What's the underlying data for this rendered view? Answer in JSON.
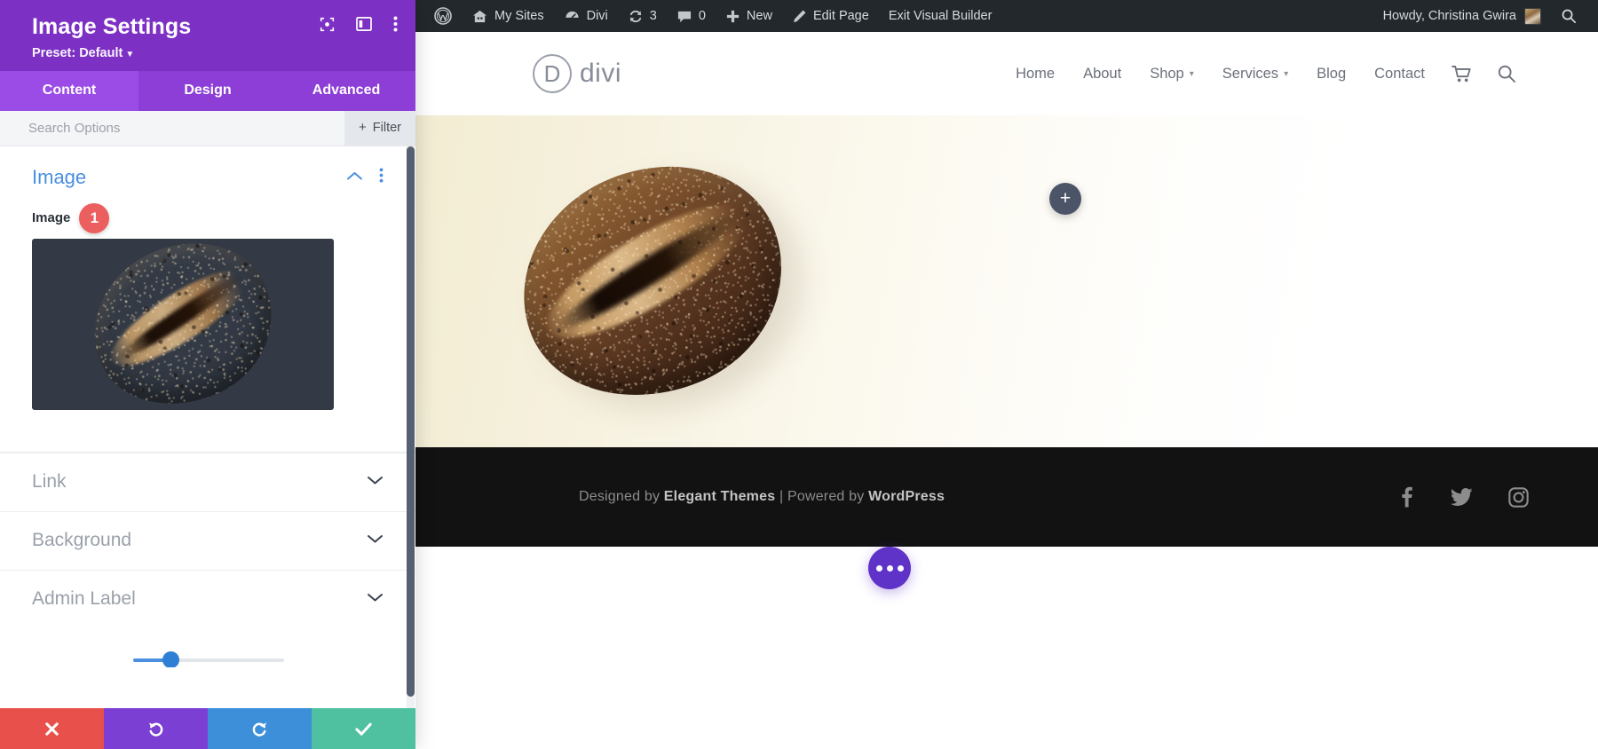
{
  "settings_panel": {
    "title": "Image Settings",
    "preset_label": "Preset: Default",
    "header_icons": [
      {
        "name": "focus-target-icon",
        "label": "Focus"
      },
      {
        "name": "panel-layout-icon",
        "label": "Layout"
      },
      {
        "name": "more-options-icon",
        "label": "More"
      }
    ],
    "tabs": [
      {
        "label": "Content",
        "active": true
      },
      {
        "label": "Design",
        "active": false
      },
      {
        "label": "Advanced",
        "active": false
      }
    ],
    "search": {
      "placeholder": "Search Options",
      "value": ""
    },
    "filter_button": {
      "label": "Filter",
      "plus": "+"
    },
    "sections": [
      {
        "title": "Image",
        "state": "expanded",
        "field_label": "Image",
        "badge": "1"
      },
      {
        "title": "Link",
        "state": "collapsed"
      },
      {
        "title": "Background",
        "state": "collapsed"
      },
      {
        "title": "Admin Label",
        "state": "collapsed"
      }
    ],
    "action_bar": [
      {
        "name": "cancel-button",
        "icon": "close-icon",
        "glyph": "✖",
        "color": "#e8514b"
      },
      {
        "name": "undo-button",
        "icon": "undo-icon",
        "glyph": "↺",
        "color": "#7b3fd4"
      },
      {
        "name": "redo-button",
        "icon": "redo-icon",
        "glyph": "↻",
        "color": "#3c8fd8"
      },
      {
        "name": "save-button",
        "icon": "check-icon",
        "glyph": "✔",
        "color": "#4fc0a0"
      }
    ]
  },
  "admin_bar": {
    "items": [
      {
        "label": "",
        "icon": "wordpress-logo-icon"
      },
      {
        "label": "My Sites",
        "icon": "sites-icon"
      },
      {
        "label": "Divi",
        "icon": "divi-dashboard-icon"
      },
      {
        "label": "3",
        "icon": "updates-icon"
      },
      {
        "label": "0",
        "icon": "comments-icon"
      },
      {
        "label": "New",
        "icon": "plus-icon"
      },
      {
        "label": "Edit Page",
        "icon": "pencil-icon"
      },
      {
        "label": "Exit Visual Builder",
        "icon": ""
      }
    ],
    "howdy": "Howdy, Christina Gwira",
    "search_icon": "search-icon"
  },
  "site": {
    "logo": {
      "mark": "D",
      "word": "divi"
    },
    "nav": [
      {
        "label": "Home",
        "has_dropdown": false
      },
      {
        "label": "About",
        "has_dropdown": false
      },
      {
        "label": "Shop",
        "has_dropdown": true
      },
      {
        "label": "Services",
        "has_dropdown": true
      },
      {
        "label": "Blog",
        "has_dropdown": false
      },
      {
        "label": "Contact",
        "has_dropdown": false
      }
    ],
    "nav_icons": [
      {
        "name": "cart-icon"
      },
      {
        "name": "search-icon"
      }
    ],
    "hero": {
      "add_module_label": "+",
      "image_alt": "rustic sourdough bread loaf"
    },
    "footer": {
      "credit_prefix": "Designed by ",
      "credit_brand": "Elegant Themes",
      "credit_sep": " | ",
      "credit_powered": "Powered by ",
      "credit_platform": "WordPress",
      "socials": [
        {
          "name": "facebook-icon"
        },
        {
          "name": "twitter-icon"
        },
        {
          "name": "instagram-icon"
        }
      ]
    },
    "fab": {
      "name": "page-settings-fab",
      "icon": "ellipsis-icon"
    }
  },
  "colors": {
    "panel_header": "#7d31c4",
    "panel_tabs": "#8c3ed6",
    "tab_active": "#9b4ce6",
    "section_open": "#4a8fe0",
    "badge": "#ec5f5f",
    "admin_bar": "#23282d",
    "footer": "#121212",
    "fab": "#5f32c8"
  }
}
